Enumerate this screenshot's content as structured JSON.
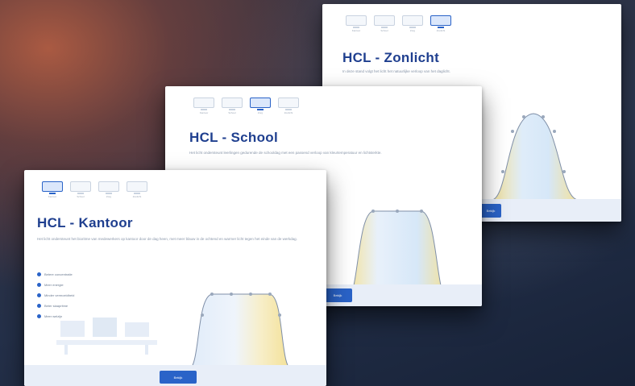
{
  "cards": {
    "zonlicht": {
      "title": "HCL - Zonlicht",
      "description": "In deze stand volgt het licht het natuurlijke verloop van het daglicht.",
      "tabs": [
        "Kantoor",
        "School",
        "Zorg",
        "Zonlicht"
      ],
      "active_tab": 3,
      "button_label": "Bekijk"
    },
    "school": {
      "title": "HCL - School",
      "description": "Het licht ondersteunt leerlingen gedurende de schooldag met een passend verloop van kleurtemperatuur en lichtsterkte.",
      "tabs": [
        "Kantoor",
        "School",
        "Zorg",
        "Zonlicht"
      ],
      "active_tab": 2,
      "button_label": "Bekijk"
    },
    "kantoor": {
      "title": "HCL - Kantoor",
      "description": "Het licht ondersteunt het bioritme van medewerkers op kantoor door de dag heen, met meer blauw in de ochtend en warmer licht tegen het einde van de werkdag.",
      "tabs": [
        "Kantoor",
        "School",
        "Zorg",
        "Zonlicht"
      ],
      "active_tab": 0,
      "features": [
        "Betere concentratie",
        "Meer energie",
        "Minder vermoeidheid",
        "Beter slaapritme",
        "Meer welzijn"
      ],
      "footnote": "",
      "button_label": "Bekijk"
    }
  },
  "colors": {
    "accent": "#2a63c8",
    "title": "#1f3f8f",
    "warm": "#f2dc86",
    "cool": "#cfe3f7"
  },
  "icons": [
    "monitor-icon",
    "bullet-icon"
  ]
}
